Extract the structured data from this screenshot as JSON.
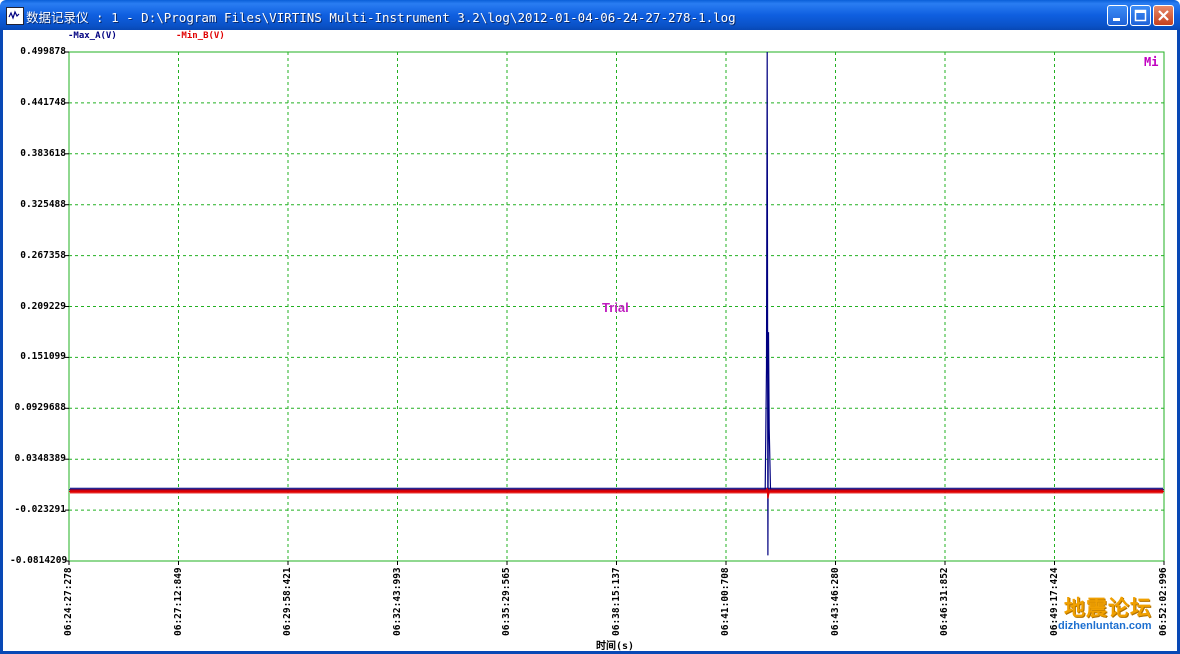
{
  "window": {
    "title": "数据记录仪 : 1 - D:\\Program Files\\VIRTINS Multi-Instrument 3.2\\log\\2012-01-04-06-24-27-278-1.log"
  },
  "legend": {
    "series_a": "-Max_A(V)",
    "series_b": "-Min_B(V)"
  },
  "overlay": {
    "trial": "Trial",
    "corner_button": "Mi"
  },
  "watermark": {
    "text": "地震论坛",
    "url": "dizhenluntan.com"
  },
  "chart_data": {
    "type": "line",
    "xlabel": "时间(s)",
    "ylabel": "",
    "ylim": [
      -0.0814209,
      0.499878
    ],
    "grid": true,
    "y_ticks": [
      "0.499878",
      "0.441748",
      "0.383618",
      "0.325488",
      "0.267358",
      "0.209229",
      "0.151099",
      "0.0929688",
      "0.0348389",
      "-0.023291",
      "-0.0814209"
    ],
    "x_ticks": [
      "06:24:27:278",
      "06:27:12:849",
      "06:29:58:421",
      "06:32:43:993",
      "06:35:29:565",
      "06:38:15:137",
      "06:41:00:708",
      "06:43:46:280",
      "06:46:31:852",
      "06:49:17:424",
      "06:52:02:996"
    ],
    "series": [
      {
        "name": "Max_A(V)",
        "color": "#000080",
        "baseline": 0.0,
        "points": [
          {
            "x": "06:24:27:278",
            "y": 0.0
          },
          {
            "x": "06:42:00:000",
            "y": 0.0
          },
          {
            "x": "06:42:02:000",
            "y": 0.14
          },
          {
            "x": "06:42:03:000",
            "y": 0.499878
          },
          {
            "x": "06:42:04:000",
            "y": -0.075
          },
          {
            "x": "06:42:05:000",
            "y": 0.18
          },
          {
            "x": "06:42:06:000",
            "y": 0.07
          },
          {
            "x": "06:42:08:000",
            "y": 0.0
          },
          {
            "x": "06:52:02:996",
            "y": 0.0
          }
        ]
      },
      {
        "name": "Min_B(V)",
        "color": "#e00000",
        "baseline": -0.002,
        "points": [
          {
            "x": "06:24:27:278",
            "y": -0.002
          },
          {
            "x": "06:42:02:000",
            "y": -0.002
          },
          {
            "x": "06:42:03:000",
            "y": 0.002
          },
          {
            "x": "06:42:04:000",
            "y": -0.01
          },
          {
            "x": "06:42:06:000",
            "y": -0.002
          },
          {
            "x": "06:52:02:996",
            "y": -0.002
          }
        ]
      }
    ],
    "colors": {
      "grid": "#22b022",
      "axis": "#22b022"
    }
  }
}
